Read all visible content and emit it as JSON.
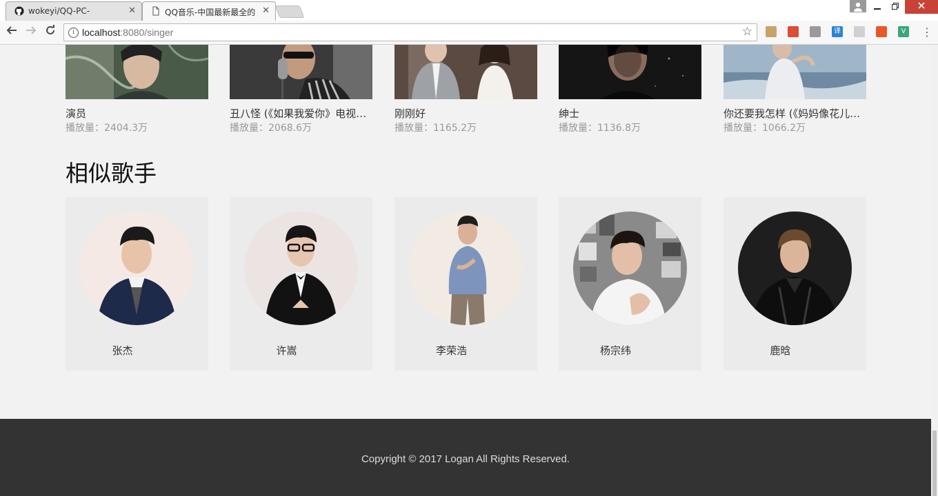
{
  "browser": {
    "tabs": [
      {
        "title": "wokeyi/QQ-PC-",
        "close": "✕"
      },
      {
        "title": "QQ音乐-中国最新最全的",
        "close": "✕"
      }
    ],
    "url_host": "localhost",
    "url_path": ":8080/singer",
    "extensions": [
      {
        "icon": "bookmark-ext-icon",
        "glyph": "",
        "color": "#c9a36a"
      },
      {
        "icon": "chrome-ext-icon",
        "glyph": "",
        "color": "#dd4b39"
      },
      {
        "icon": "block-ext-icon",
        "glyph": "",
        "color": "#9a9a9a"
      },
      {
        "icon": "translate-ext-icon",
        "glyph": "译",
        "color": "#2a83d8"
      },
      {
        "icon": "feather-ext-icon",
        "glyph": "",
        "color": "#d0d0d0"
      },
      {
        "icon": "tool-ext-icon",
        "glyph": "",
        "color": "#e8572a"
      },
      {
        "icon": "vue-devtools-icon",
        "glyph": "V",
        "color": "#3aa776"
      }
    ]
  },
  "songs": [
    {
      "name": "演员",
      "plays": "播放量：2404.3万"
    },
    {
      "name": "丑八怪 (《如果我爱你》电视剧插曲)",
      "plays": "播放量：2068.6万"
    },
    {
      "name": "刚刚好",
      "plays": "播放量：1165.2万"
    },
    {
      "name": "绅士",
      "plays": "播放量：1136.8万"
    },
    {
      "name": "你还要我怎样 (《妈妈像花儿一样》电视剧插曲)",
      "plays": "播放量：1066.2万"
    }
  ],
  "similar": {
    "title": "相似歌手",
    "singers": [
      {
        "name": "张杰",
        "avatar_bg": "#f4e9e4"
      },
      {
        "name": "许嵩",
        "avatar_bg": "#ece4e2"
      },
      {
        "name": "李荣浩",
        "avatar_bg": "#f1ebe4"
      },
      {
        "name": "杨宗纬",
        "avatar_bg": "#8a8a8a"
      },
      {
        "name": "鹿晗",
        "avatar_bg": "#1e1e1e"
      }
    ]
  },
  "footer": {
    "copyright": "Copyright © 2017 Logan All Rights Reserved."
  }
}
